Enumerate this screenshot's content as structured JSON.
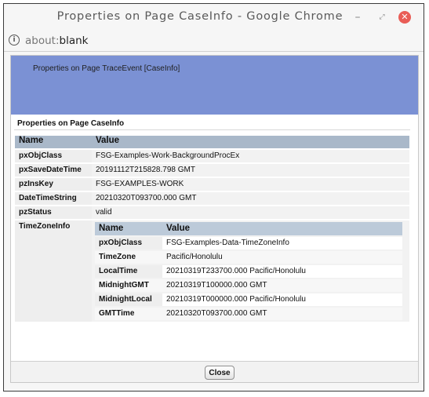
{
  "window": {
    "title": "Properties on Page CaseInfo - Google Chrome",
    "minimize": "–",
    "maximize": "⤢",
    "close": "✕"
  },
  "urlbar": {
    "scheme": "about:",
    "rest": "blank",
    "info_icon": "i"
  },
  "banner": {
    "text": "Properties on Page TraceEvent [CaseInfo]"
  },
  "section": {
    "title": "Properties on Page CaseInfo"
  },
  "table": {
    "headers": [
      "Name",
      "Value"
    ],
    "rows": [
      {
        "name": "pxObjClass",
        "value": "FSG-Examples-Work-BackgroundProcEx"
      },
      {
        "name": "pxSaveDateTime",
        "value": "20191112T215828.798 GMT"
      },
      {
        "name": "pzInsKey",
        "value": "FSG-EXAMPLES-WORK"
      },
      {
        "name": "DateTimeString",
        "value": "20210320T093700.000 GMT"
      },
      {
        "name": "pzStatus",
        "value": "valid"
      }
    ],
    "nested_row_name": "TimeZoneInfo"
  },
  "nested": {
    "headers": [
      "Name",
      "Value"
    ],
    "rows": [
      {
        "name": "pxObjClass",
        "value": "FSG-Examples-Data-TimeZoneInfo"
      },
      {
        "name": "TimeZone",
        "value": "Pacific/Honolulu"
      },
      {
        "name": "LocalTime",
        "value": "20210319T233700.000 Pacific/Honolulu"
      },
      {
        "name": "MidnightGMT",
        "value": "20210319T100000.000 GMT"
      },
      {
        "name": "MidnightLocal",
        "value": "20210319T000000.000 Pacific/Honolulu"
      },
      {
        "name": "GMTTime",
        "value": "20210320T093700.000 GMT"
      }
    ]
  },
  "footer": {
    "close_label": "Close"
  }
}
